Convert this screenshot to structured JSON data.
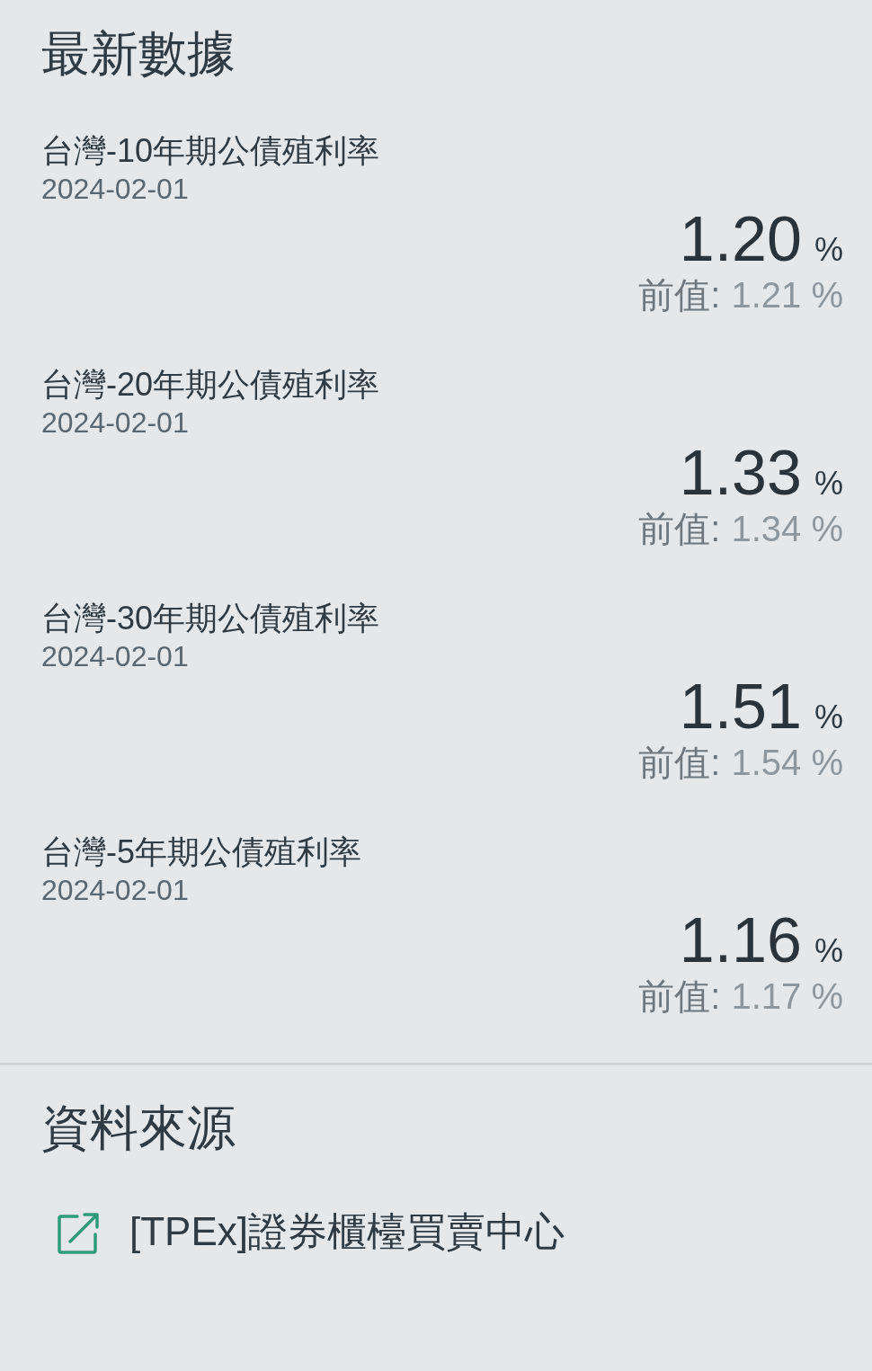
{
  "latest": {
    "heading": "最新數據",
    "items": [
      {
        "title": "台灣-10年期公債殖利率",
        "date": "2024-02-01",
        "value": "1.20",
        "unit": "%",
        "previous_label": "前值:",
        "previous_value": "1.21 %"
      },
      {
        "title": "台灣-20年期公債殖利率",
        "date": "2024-02-01",
        "value": "1.33",
        "unit": "%",
        "previous_label": "前值:",
        "previous_value": "1.34 %"
      },
      {
        "title": "台灣-30年期公債殖利率",
        "date": "2024-02-01",
        "value": "1.51",
        "unit": "%",
        "previous_label": "前值:",
        "previous_value": "1.54 %"
      },
      {
        "title": "台灣-5年期公債殖利率",
        "date": "2024-02-01",
        "value": "1.16",
        "unit": "%",
        "previous_label": "前值:",
        "previous_value": "1.17 %"
      }
    ]
  },
  "source": {
    "heading": "資料來源",
    "link": "[TPEx]證券櫃檯買賣中心"
  }
}
